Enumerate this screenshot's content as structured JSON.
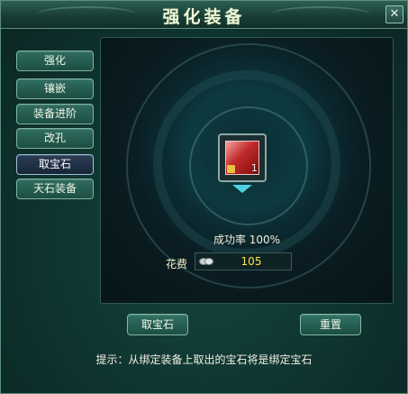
{
  "window": {
    "title": "强化装备",
    "close_label": "✕"
  },
  "nav": {
    "items": [
      {
        "label": "强化"
      },
      {
        "label": "镶嵌"
      },
      {
        "label": "装备进阶"
      },
      {
        "label": "改孔"
      },
      {
        "label": "取宝石",
        "active": true
      },
      {
        "label": "天石装备"
      }
    ]
  },
  "slot": {
    "count": "1",
    "icon": "armor-item-icon"
  },
  "info": {
    "success_rate": "成功率 100%",
    "fee_label": "花费",
    "fee_value": "105",
    "fee_icon": "silver-coin-icon"
  },
  "buttons": {
    "extract_label": "取宝石",
    "reset_label": "重置"
  },
  "tip": "提示：从绑定装备上取出的宝石将是绑定宝石",
  "colors": {
    "panel": "#0f3430",
    "border": "#5d8f7c",
    "fee_value": "#ffe14a",
    "arrow": "#4fd2e0"
  }
}
